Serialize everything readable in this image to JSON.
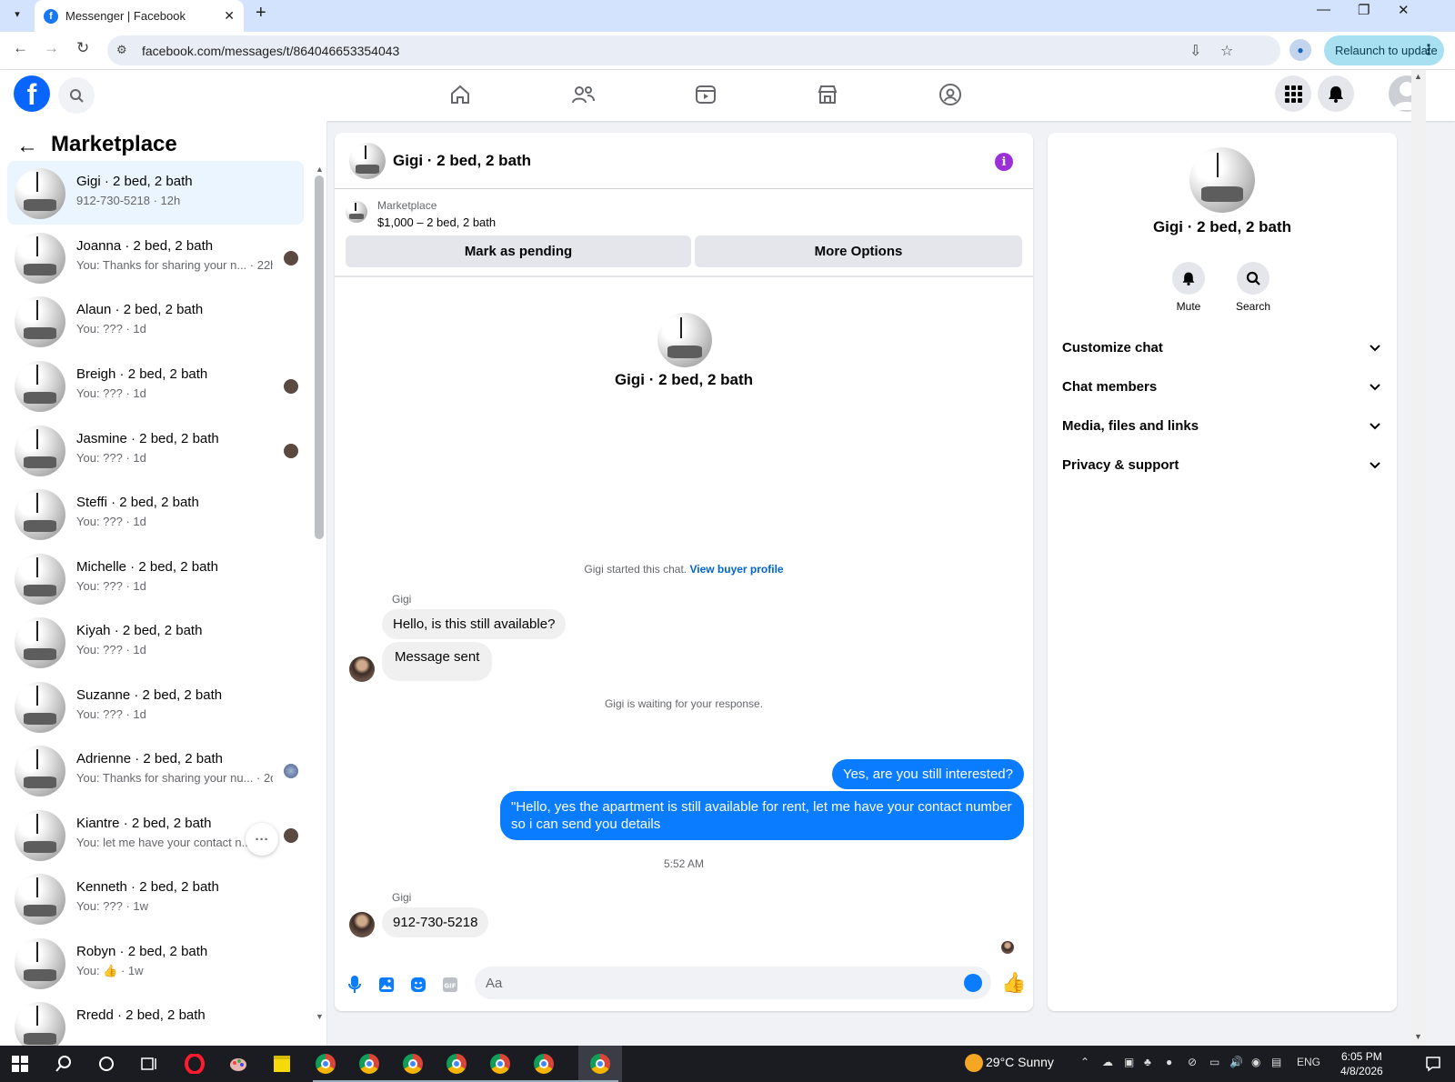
{
  "browser": {
    "tab_title": "Messenger | Facebook",
    "url": "facebook.com/messages/t/864046653354043",
    "relaunch_label": "Relaunch to update"
  },
  "sidebar": {
    "title": "Marketplace",
    "conversations": [
      {
        "name": "Gigi · 2 bed, 2 bath",
        "preview": "912-730-5218 · 12h",
        "active": true
      },
      {
        "name": "Joanna · 2 bed, 2 bath",
        "preview": "You: Thanks for sharing your n... · 22h"
      },
      {
        "name": "Alaun · 2 bed, 2 bath",
        "preview": "You: ??? · 1d"
      },
      {
        "name": "Breigh · 2 bed, 2 bath",
        "preview": "You: ??? · 1d"
      },
      {
        "name": "Jasmine · 2 bed, 2 bath",
        "preview": "You: ??? · 1d"
      },
      {
        "name": "Steffi · 2 bed, 2 bath",
        "preview": "You: ??? · 1d"
      },
      {
        "name": "Michelle · 2 bed, 2 bath",
        "preview": "You: ??? · 1d"
      },
      {
        "name": "Kiyah · 2 bed, 2 bath",
        "preview": "You: ??? · 1d"
      },
      {
        "name": "Suzanne · 2 bed, 2 bath",
        "preview": "You: ??? · 1d"
      },
      {
        "name": "Adrienne · 2 bed, 2 bath",
        "preview": "You: Thanks for sharing your nu... · 2d"
      },
      {
        "name": "Kiantre · 2 bed, 2 bath",
        "preview": "You: let me have your contact n..."
      },
      {
        "name": "Kenneth · 2 bed, 2 bath",
        "preview": "You: ??? · 1w"
      },
      {
        "name": "Robyn · 2 bed, 2 bath",
        "preview": "You: 👍 · 1w"
      },
      {
        "name": "Rredd · 2 bed, 2 bath",
        "preview": ""
      }
    ]
  },
  "chat": {
    "title": "Gigi · 2 bed, 2 bath",
    "listing_source": "Marketplace",
    "listing_price": "$1,000 – 2 bed, 2 bath",
    "mark_pending_label": "Mark as pending",
    "more_options_label": "More Options",
    "intro_name": "Gigi · 2 bed, 2 bath",
    "started_text": "Gigi started this chat.",
    "view_profile_label": "View buyer profile",
    "sender_name": "Gigi",
    "msg1": "Hello, is this still available?",
    "msg2": "Message sent",
    "waiting_text": "Gigi is waiting for your response.",
    "out1": "Yes, are you still interested?",
    "out2": "\"Hello, yes the apartment is still available for rent, let me have your contact number so i can send you details",
    "timestamp": "5:52 AM",
    "sender_name2": "Gigi",
    "msg3": "912-730-5218",
    "composer_placeholder": "Aa"
  },
  "info_panel": {
    "name": "Gigi · 2 bed, 2 bath",
    "mute_label": "Mute",
    "search_label": "Search",
    "sections": [
      "Customize chat",
      "Chat members",
      "Media, files and links",
      "Privacy & support"
    ]
  },
  "taskbar": {
    "weather": "29°C  Sunny",
    "lang": "ENG",
    "time": "6:05 PM",
    "date": "4/8/2026"
  },
  "colors": {
    "accent": "#0a7cff",
    "fb_blue": "#0866ff",
    "info_purple": "#9b30d9"
  }
}
